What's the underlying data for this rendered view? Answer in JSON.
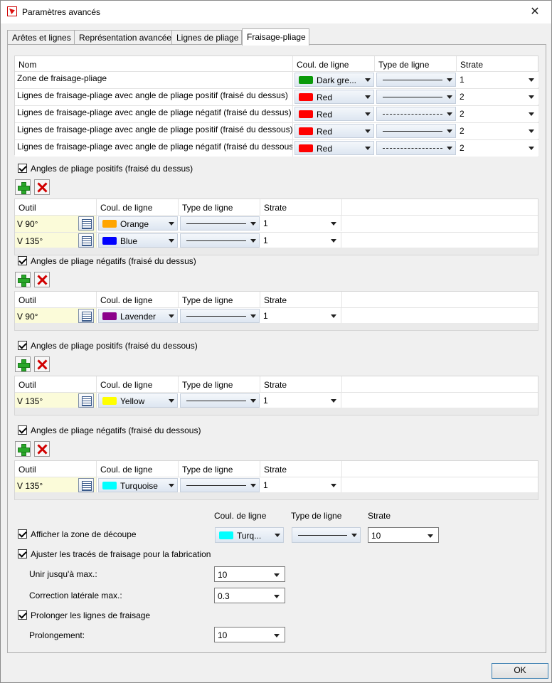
{
  "window": {
    "title": "Paramètres avancés"
  },
  "tabs": [
    "Arêtes et lignes",
    "Représentation avancée",
    "Lignes de pliage",
    "Fraisage-pliage"
  ],
  "main_table": {
    "headers": [
      "Nom",
      "Coul. de ligne",
      "Type de ligne",
      "Strate"
    ],
    "rows": [
      {
        "name": "Zone de fraisage-pliage",
        "color_name": "Dark gre...",
        "color": "#0a9a0a",
        "line": "solid",
        "strate": "1"
      },
      {
        "name": "Lignes de fraisage-pliage avec angle de pliage positif (fraisé du dessus)",
        "color_name": "Red",
        "color": "#ff0000",
        "line": "solid",
        "strate": "2"
      },
      {
        "name": "Lignes de fraisage-pliage avec angle de pliage négatif (fraisé du dessus)",
        "color_name": "Red",
        "color": "#ff0000",
        "line": "dashed",
        "strate": "2"
      },
      {
        "name": "Lignes de fraisage-pliage avec angle de pliage positif (fraisé du dessous)",
        "color_name": "Red",
        "color": "#ff0000",
        "line": "solid",
        "strate": "2"
      },
      {
        "name": "Lignes de fraisage-pliage avec angle de pliage négatif (fraisé du dessous)",
        "color_name": "Red",
        "color": "#ff0000",
        "line": "dashed",
        "strate": "2"
      }
    ]
  },
  "subheaders": [
    "Outil",
    "Coul. de ligne",
    "Type de ligne",
    "Strate"
  ],
  "groups": [
    {
      "label": "Angles de pliage positifs (fraisé du dessus)",
      "rows": [
        {
          "tool": "V 90°",
          "color_name": "Orange",
          "color": "#ffa500",
          "strate": "1"
        },
        {
          "tool": "V 135°",
          "color_name": "Blue",
          "color": "#0000ff",
          "strate": "1"
        }
      ]
    },
    {
      "label": "Angles de pliage négatifs (fraisé du dessus)",
      "rows": [
        {
          "tool": "V 90°",
          "color_name": "Lavender",
          "color": "#8b008b",
          "strate": "1"
        }
      ]
    },
    {
      "label": "Angles de pliage positifs (fraisé du dessous)",
      "rows": [
        {
          "tool": "V 135°",
          "color_name": "Yellow",
          "color": "#ffff00",
          "strate": "1"
        }
      ]
    },
    {
      "label": "Angles de pliage négatifs (fraisé du dessous)",
      "rows": [
        {
          "tool": "V 135°",
          "color_name": "Turquoise",
          "color": "#00ffff",
          "strate": "1"
        }
      ]
    }
  ],
  "bottom": {
    "col_color": "Coul. de ligne",
    "col_type": "Type de ligne",
    "col_strate": "Strate",
    "show_cut_zone": {
      "label": "Afficher la zone de découpe",
      "color_name": "Turq...",
      "color": "#00ffff",
      "strate": "10"
    },
    "adjust": {
      "label": "Ajuster les tracés de fraisage pour la fabrication"
    },
    "unite": {
      "label": "Unir jusqu'à max.:",
      "value": "10"
    },
    "correction": {
      "label": "Correction latérale max.:",
      "value": "0.3"
    },
    "extend": {
      "label": "Prolonger les lignes de fraisage"
    },
    "prolongement": {
      "label": "Prolongement:",
      "value": "10"
    }
  },
  "ok_label": "OK"
}
